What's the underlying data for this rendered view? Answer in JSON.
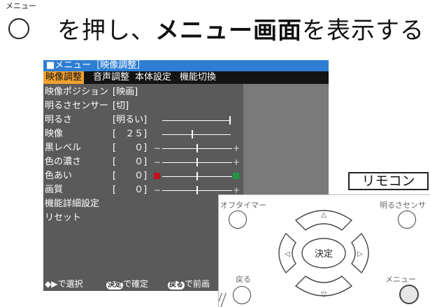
{
  "heading": {
    "ruby": "メニュー",
    "pre": "を押し、",
    "bold1": "メニュー",
    "bold2": "画面",
    "post": "を表示する"
  },
  "osd": {
    "title": "■メニュー［映像調整］",
    "tabs": [
      "映像調整",
      "音声調整",
      "本体設定",
      "機能切換"
    ],
    "active_tab": "映像調整",
    "rows": [
      {
        "label": "映像ポジション",
        "value": "[映画]"
      },
      {
        "label": "明るさセンサー",
        "value": "[切]"
      },
      {
        "label": "明るさ",
        "value": "[明るい]"
      },
      {
        "label": "映像",
        "value": "[　２５]"
      },
      {
        "label": "黒レベル",
        "value": "[　　０]"
      },
      {
        "label": "色の濃さ",
        "value": "[　　０]"
      },
      {
        "label": "色あい",
        "value": "[　　０]"
      },
      {
        "label": "画質",
        "value": "[　　０]"
      },
      {
        "label": "機能詳細設定",
        "value": ""
      },
      {
        "label": "リセット",
        "value": ""
      }
    ],
    "footer": {
      "select": "で選択",
      "select_icon": "◆▶",
      "confirm_key": "決定",
      "confirm": "で確定",
      "back_key": "戻る",
      "back": "で前画"
    },
    "colors": {
      "title_bar": "#2e7fd4",
      "active_tab": "#f0a030",
      "hue_left": "#c0141c",
      "hue_right": "#1a9a40"
    }
  },
  "remote": {
    "label": "リモコン",
    "off_timer": "オフタイマー",
    "brightness_sensor": "明るさセンサ",
    "up_icon": "△",
    "down_icon": "▽",
    "left_icon": "◁",
    "right_icon": "▷",
    "enter": "決定",
    "back": "戻る",
    "menu": "メニュー"
  }
}
